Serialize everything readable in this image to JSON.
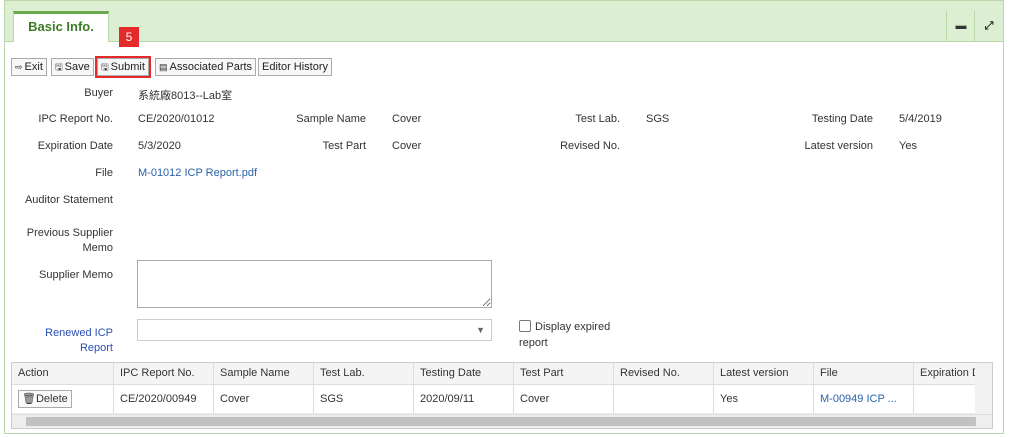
{
  "tab": {
    "label": "Basic Info."
  },
  "header_buttons": {
    "minimize": "▬",
    "expand": "⤢"
  },
  "badge": "5",
  "toolbar": {
    "exit": "Exit",
    "save": "Save",
    "submit": "Submit",
    "associated_parts": "Associated Parts",
    "editor_history": "Editor History"
  },
  "form": {
    "buyer_label": "Buyer",
    "buyer_value": "系統廠8013--Lab室",
    "ipc_report_no_label": "IPC Report No.",
    "ipc_report_no_value": "CE/2020/01012",
    "sample_name_label": "Sample Name",
    "sample_name_value": "Cover",
    "test_lab_label": "Test Lab.",
    "test_lab_value": "SGS",
    "testing_date_label": "Testing Date",
    "testing_date_value": "5/4/2019",
    "expiration_date_label": "Expiration Date",
    "expiration_date_value": "5/3/2020",
    "test_part_label": "Test Part",
    "test_part_value": "Cover",
    "revised_no_label": "Revised No.",
    "latest_version_label": "Latest version",
    "latest_version_value": "Yes",
    "file_label": "File",
    "file_value": "M-01012 ICP Report.pdf",
    "auditor_statement_label": "Auditor Statement",
    "previous_supplier_memo_label_1": "Previous Supplier",
    "previous_supplier_memo_label_2": "Memo",
    "supplier_memo_label": "Supplier Memo",
    "renewed_icp_label_1": "Renewed ICP",
    "renewed_icp_label_2": "Report",
    "display_expired_label_1": "Display expired",
    "display_expired_label_2": "report"
  },
  "grid": {
    "headers": [
      "Action",
      "IPC Report No.",
      "Sample Name",
      "Test Lab.",
      "Testing Date",
      "Test Part",
      "Revised No.",
      "Latest version",
      "File",
      "Expiration Da"
    ],
    "row": {
      "action": "Delete",
      "ipc_report_no": "CE/2020/00949",
      "sample_name": "Cover",
      "test_lab": "SGS",
      "testing_date": "2020/09/11",
      "test_part": "Cover",
      "revised_no": "",
      "latest_version": "Yes",
      "file": "M-00949 ICP ...",
      "expiration_date": ""
    }
  },
  "colors": {
    "header_bg": "#dcefd2",
    "accent": "#6aa84f",
    "highlight": "#e32b2b",
    "link": "#2a63a8"
  }
}
